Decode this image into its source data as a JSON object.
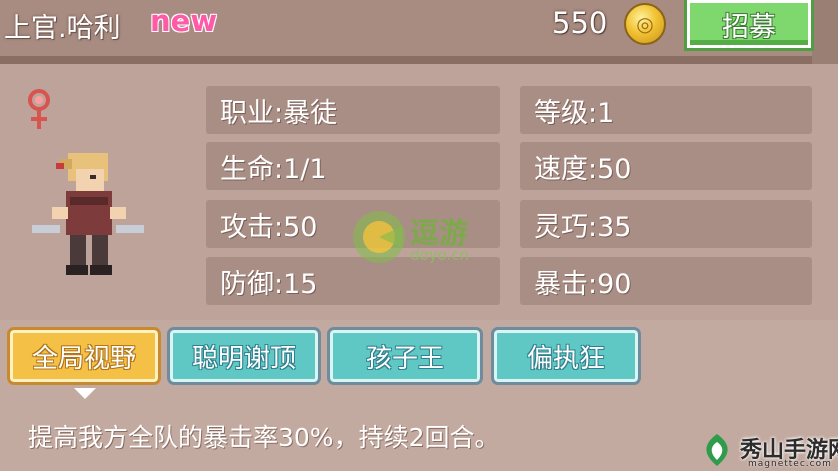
{
  "header": {
    "hero_name": "上官.哈利",
    "new_tag": "new",
    "gold_amount": "550",
    "coin_icon": "coin-icon",
    "recruit_label": "招募"
  },
  "hero": {
    "gender_icon": "female-icon",
    "portrait_icon": "hero-portrait"
  },
  "stats": [
    {
      "label": "职业",
      "sep": ":",
      "value": "暴徒",
      "text": "职业:暴徒"
    },
    {
      "label": "等级",
      "sep": ":",
      "value": "1",
      "text": "等级:1"
    },
    {
      "label": "生命",
      "sep": ":",
      "value": "1/1",
      "text": "生命:1/1"
    },
    {
      "label": "速度",
      "sep": ":",
      "value": "50",
      "text": "速度:50"
    },
    {
      "label": "攻击",
      "sep": ":",
      "value": "50",
      "text": "攻击:50"
    },
    {
      "label": "灵巧",
      "sep": ":",
      "value": "35",
      "text": "灵巧:35"
    },
    {
      "label": "防御",
      "sep": ":",
      "value": "15",
      "text": "防御:15"
    },
    {
      "label": "暴击",
      "sep": ":",
      "value": "90",
      "text": "暴击:90"
    }
  ],
  "skills": {
    "tabs": [
      {
        "label": "全局视野",
        "active": true
      },
      {
        "label": "聪明谢顶",
        "active": false
      },
      {
        "label": "孩子王",
        "active": false
      },
      {
        "label": "偏执狂",
        "active": false
      }
    ],
    "description": "提高我方全队的暴击率30%，持续2回合。"
  },
  "watermark": {
    "name": "逗游",
    "url": "doyo.cn"
  },
  "site": {
    "name": "秀山手游网",
    "url": "magnettec.com"
  },
  "colors": {
    "panel": "#bda39a",
    "stat_cell": "#a98e85",
    "active_tab": "#f5c046",
    "idle_tab": "#5fc8c4",
    "recruit": "#7ed86d",
    "new_tag": "#ff5aa8"
  }
}
